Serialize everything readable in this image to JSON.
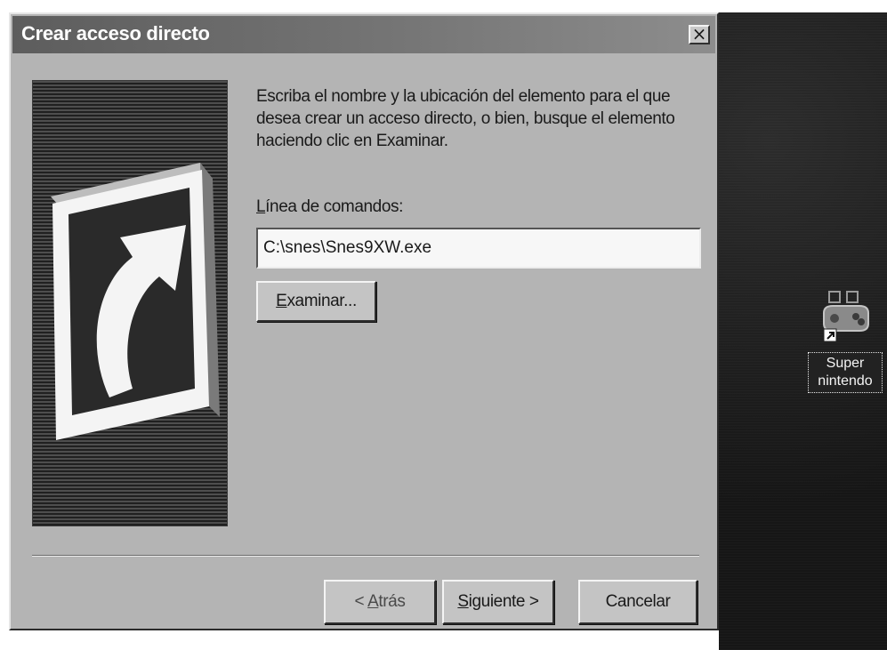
{
  "dialog": {
    "title": "Crear acceso directo",
    "close_glyph": "×",
    "description": "Escriba el nombre y la ubicación del elemento para el que desea crear un acceso directo, o bien, busque el elemento haciendo clic en Examinar.",
    "command_label": {
      "accelerator": "L",
      "rest": "ínea de comandos:"
    },
    "command_value": "C:\\snes\\Snes9XW.exe",
    "browse_button": {
      "accelerator": "E",
      "rest": "xaminar..."
    },
    "back_button": {
      "prefix": "< ",
      "accelerator": "A",
      "rest": "trás"
    },
    "next_button": {
      "accelerator": "S",
      "rest": "iguiente >"
    },
    "cancel_button": "Cancelar",
    "graphic_icon": "shortcut-arrow-icon"
  },
  "desktop": {
    "icon": {
      "name": "game-controller-icon",
      "overlay": "shortcut-arrow-icon",
      "label": "Super nintendo"
    }
  },
  "colors": {
    "dialog_face": "#b4b4b4",
    "title_bar": "#6a6a6a",
    "title_text": "#ffffff",
    "desktop": "#1c1c1c"
  }
}
